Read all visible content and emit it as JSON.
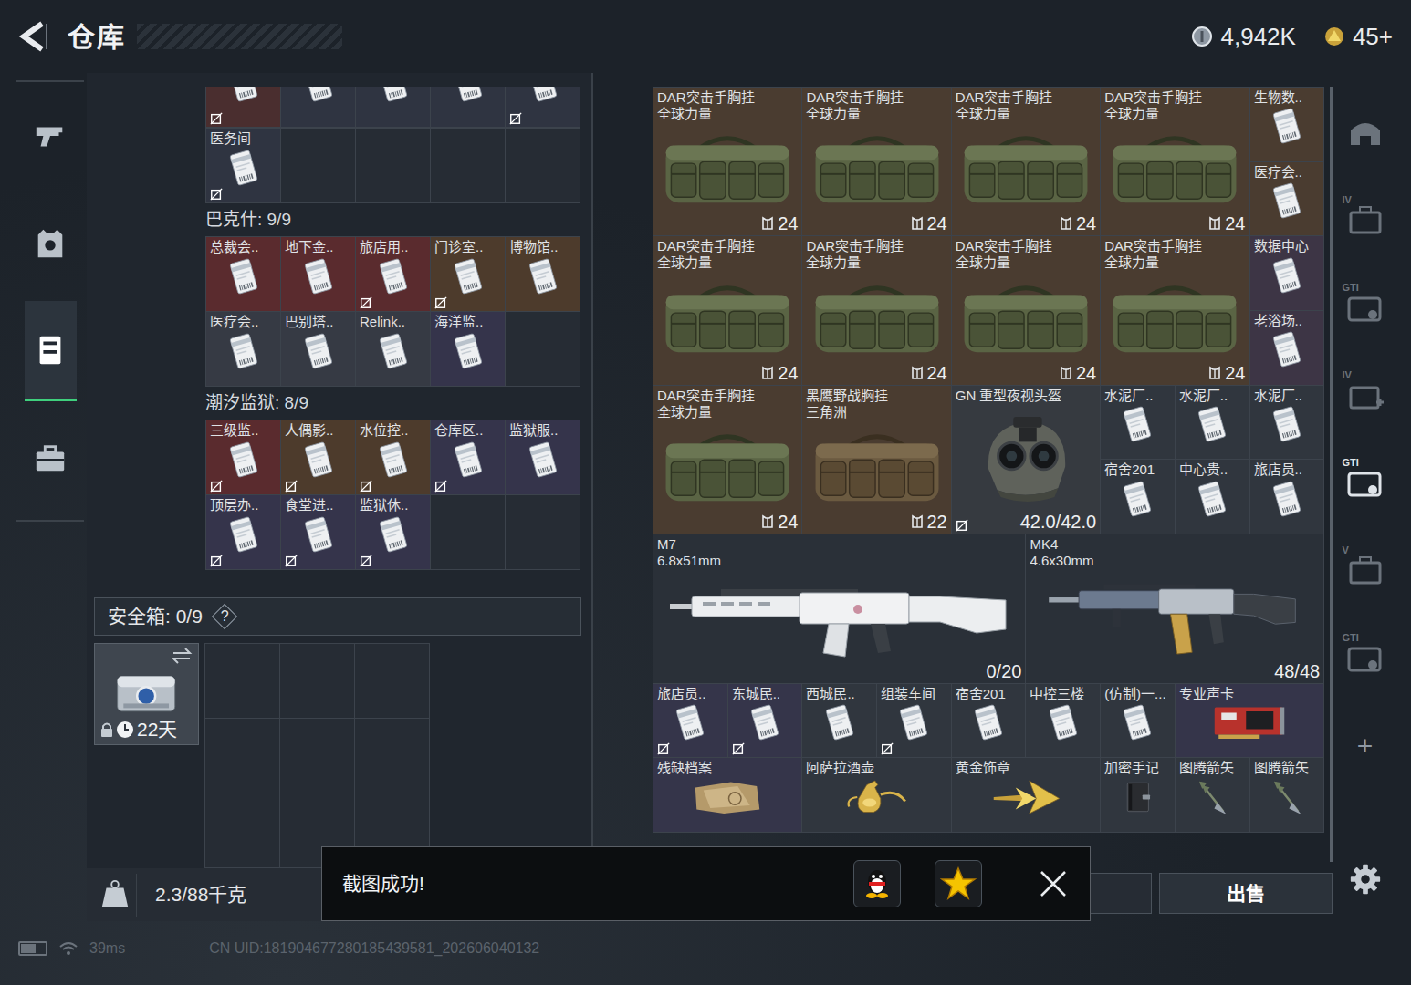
{
  "header": {
    "title": "仓库",
    "currencies": [
      {
        "kind": "silver",
        "value": "4,942K"
      },
      {
        "kind": "gold",
        "value": "45+"
      }
    ]
  },
  "nav": [
    {
      "kind": "gun",
      "selected": false
    },
    {
      "kind": "vest",
      "selected": false
    },
    {
      "kind": "locker",
      "selected": true
    },
    {
      "kind": "case",
      "selected": false
    }
  ],
  "key_sections": [
    {
      "rows": [
        {
          "clipped": true,
          "slots": [
            {
              "kind": "card",
              "locked": true,
              "color": "#4a2e2f"
            },
            {
              "kind": "card",
              "locked": false,
              "color": "#2f3441"
            },
            {
              "kind": "card",
              "locked": false,
              "color": "#2f3441"
            },
            {
              "kind": "card",
              "locked": false,
              "color": "#2f3441"
            },
            {
              "kind": "card",
              "locked": true,
              "color": "#2f3441"
            }
          ]
        },
        {
          "clipped": false,
          "slots": [
            {
              "kind": "card",
              "name": "医务间",
              "locked": true,
              "color": "#2f3441"
            },
            {
              "kind": "empty"
            },
            {
              "kind": "empty"
            },
            {
              "kind": "empty"
            },
            {
              "kind": "empty"
            }
          ]
        }
      ]
    },
    {
      "label": "巴克什: 9/9",
      "rows": [
        {
          "clipped": false,
          "slots": [
            {
              "kind": "card",
              "name": "总裁会..",
              "locked": false,
              "color": "#5a2b2e"
            },
            {
              "kind": "card",
              "name": "地下金..",
              "locked": false,
              "color": "#5a2b2e"
            },
            {
              "kind": "card",
              "name": "旅店用..",
              "locked": true,
              "color": "#5a2b2e"
            },
            {
              "kind": "card",
              "name": "门诊室..",
              "locked": true,
              "color": "#4d3b2c"
            },
            {
              "kind": "card",
              "name": "博物馆..",
              "locked": false,
              "color": "#4d3b2c"
            }
          ]
        },
        {
          "clipped": false,
          "slots": [
            {
              "kind": "card",
              "name": "医疗会..",
              "locked": false,
              "color": "#363a44"
            },
            {
              "kind": "card",
              "name": "巴别塔..",
              "locked": false,
              "color": "#363a44"
            },
            {
              "kind": "card",
              "name": "Relink..",
              "locked": false,
              "color": "#363a44"
            },
            {
              "kind": "card",
              "name": "海洋监..",
              "locked": false,
              "color": "#35344b"
            },
            {
              "kind": "empty"
            }
          ]
        }
      ]
    },
    {
      "label": "潮汐监狱: 8/9",
      "rows": [
        {
          "clipped": false,
          "slots": [
            {
              "kind": "card",
              "name": "三级监..",
              "locked": true,
              "color": "#5a2b2e"
            },
            {
              "kind": "card",
              "name": "人偶影..",
              "locked": true,
              "color": "#4d3b2c"
            },
            {
              "kind": "card",
              "name": "水位控..",
              "locked": true,
              "color": "#4d3b2c"
            },
            {
              "kind": "card",
              "name": "仓库区..",
              "locked": true,
              "color": "#35344b"
            },
            {
              "kind": "card",
              "name": "监狱服..",
              "locked": false,
              "color": "#35344b"
            }
          ]
        },
        {
          "clipped": false,
          "slots": [
            {
              "kind": "card",
              "name": "顶层办..",
              "locked": true,
              "color": "#35344b"
            },
            {
              "kind": "card",
              "name": "食堂进..",
              "locked": true,
              "color": "#35344b"
            },
            {
              "kind": "card",
              "name": "监狱休..",
              "locked": true,
              "color": "#35344b"
            },
            {
              "kind": "empty"
            },
            {
              "kind": "empty"
            }
          ]
        }
      ]
    }
  ],
  "safe": {
    "label": "安全箱: 0/9",
    "help": "?",
    "item": {
      "days": "22天",
      "locked": true
    },
    "slots": [
      {
        "kind": "empty"
      },
      {
        "kind": "empty"
      },
      {
        "kind": "empty"
      },
      {
        "kind": "empty"
      },
      {
        "kind": "empty"
      },
      {
        "kind": "empty"
      },
      {
        "kind": "empty"
      },
      {
        "kind": "empty"
      },
      {
        "kind": "empty"
      }
    ]
  },
  "weight": {
    "value": "2.3/88千克"
  },
  "stash": [
    {
      "kind": "bag",
      "name": "DAR突击手胸挂",
      "sub": "全球力量",
      "value": "24",
      "locked": false,
      "color": "#4a3c30"
    },
    {
      "kind": "bag",
      "name": "DAR突击手胸挂",
      "sub": "全球力量",
      "value": "24",
      "locked": false,
      "color": "#4a3c30"
    },
    {
      "kind": "bag",
      "name": "DAR突击手胸挂",
      "sub": "全球力量",
      "value": "24",
      "locked": false,
      "color": "#4a3c30"
    },
    {
      "kind": "bag",
      "name": "DAR突击手胸挂",
      "sub": "全球力量",
      "value": "24",
      "locked": false,
      "color": "#4a3c30"
    },
    {
      "kind": "card",
      "name": "生物数..",
      "locked": false,
      "color": "#4a3c30"
    },
    {
      "kind": "card",
      "name": "医疗会..",
      "locked": false,
      "color": "#4a3c30"
    },
    {
      "kind": "bag",
      "name": "DAR突击手胸挂",
      "sub": "全球力量",
      "value": "24",
      "locked": false,
      "color": "#4a3c30"
    },
    {
      "kind": "bag",
      "name": "DAR突击手胸挂",
      "sub": "全球力量",
      "value": "24",
      "locked": false,
      "color": "#4a3c30"
    },
    {
      "kind": "bag",
      "name": "DAR突击手胸挂",
      "sub": "全球力量",
      "value": "24",
      "locked": false,
      "color": "#4a3c30"
    },
    {
      "kind": "bag",
      "name": "DAR突击手胸挂",
      "sub": "全球力量",
      "value": "24",
      "locked": false,
      "color": "#4a3c30"
    },
    {
      "kind": "card",
      "name": "数据中心",
      "locked": false,
      "color": "#3d3545"
    },
    {
      "kind": "card",
      "name": "老浴场..",
      "locked": false,
      "color": "#3d3545"
    },
    {
      "kind": "bag",
      "name": "DAR突击手胸挂",
      "sub": "全球力量",
      "value": "24",
      "locked": false,
      "color": "#4a3c30"
    },
    {
      "kind": "bag-tan",
      "name": "黑鹰野战胸挂",
      "sub": "三角洲",
      "value": "22",
      "locked": false,
      "color": "#4a3c30"
    },
    {
      "kind": "helmet",
      "name": "GN 重型夜视头盔",
      "value": "42.0/42.0",
      "locked": true,
      "color": "#363a40"
    },
    {
      "kind": "card",
      "name": "水泥厂..",
      "locked": false,
      "color": "#30363e"
    },
    {
      "kind": "card",
      "name": "水泥厂..",
      "locked": false,
      "color": "#30363e"
    },
    {
      "kind": "card",
      "name": "水泥厂..",
      "locked": false,
      "color": "#30363e"
    },
    {
      "kind": "card",
      "name": "宿舍201",
      "locked": false,
      "color": "#30363e"
    },
    {
      "kind": "card",
      "name": "中心贵..",
      "locked": false,
      "color": "#30363e"
    },
    {
      "kind": "card",
      "name": "旅店员..",
      "locked": false,
      "color": "#30363e"
    },
    {
      "kind": "rifle5",
      "name": "M7",
      "sub": "6.8x51mm",
      "value": "0/20",
      "locked": false,
      "color": "#2a3038"
    },
    {
      "kind": "rifle4",
      "name": "MK4",
      "sub": "4.6x30mm",
      "value": "48/48",
      "locked": false,
      "color": "#2a3038"
    },
    {
      "kind": "card",
      "name": "旅店员..",
      "locked": true,
      "color": "#35354a"
    },
    {
      "kind": "card",
      "name": "东城民..",
      "locked": true,
      "color": "#35354a"
    },
    {
      "kind": "card",
      "name": "西城民..",
      "locked": false,
      "color": "#30363e"
    },
    {
      "kind": "card",
      "name": "组装车间",
      "locked": true,
      "color": "#30363e"
    },
    {
      "kind": "card",
      "name": "宿舍201",
      "locked": false,
      "color": "#30363e"
    },
    {
      "kind": "card",
      "name": "中控三楼",
      "locked": false,
      "color": "#30363e"
    },
    {
      "kind": "card",
      "name": "(仿制)一...",
      "locked": false,
      "color": "#30363e"
    },
    {
      "kind": "soundcard",
      "name": "专业声卡",
      "locked": false,
      "color": "#35354a"
    },
    {
      "kind": "document",
      "name": "残缺档案",
      "locked": false,
      "color": "#35354a"
    },
    {
      "kind": "flask",
      "name": "阿萨拉酒壶",
      "locked": false,
      "color": "#30363e"
    },
    {
      "kind": "emblem",
      "name": "黄金饰章",
      "locked": false,
      "color": "#30363e"
    },
    {
      "kind": "notebook",
      "name": "加密手记",
      "locked": false,
      "color": "#30363e"
    },
    {
      "kind": "arrow",
      "name": "图腾箭矢",
      "locked": false,
      "color": "#30363e"
    },
    {
      "kind": "arrow",
      "name": "图腾箭矢",
      "locked": false,
      "color": "#30363e"
    }
  ],
  "rail": {
    "items": [
      {
        "kind": "bunker",
        "label": "",
        "selected": false
      },
      {
        "kind": "case",
        "label": "IV",
        "selected": false
      },
      {
        "kind": "ticket",
        "label": "GTI",
        "selected": false
      },
      {
        "kind": "medkit",
        "label": "IV",
        "selected": false
      },
      {
        "kind": "ticket",
        "label": "GTI",
        "selected": true
      },
      {
        "kind": "case",
        "label": "V",
        "selected": false
      },
      {
        "kind": "ticket",
        "label": "GTI",
        "selected": false
      }
    ],
    "add": "+"
  },
  "actions": {
    "sell": "出售"
  },
  "toast": {
    "message": "截图成功!"
  },
  "status_bar": {
    "battery": {
      "level": 0.6
    },
    "latency": "39ms",
    "uid": "CN UID:181904677280185439581_202606040132"
  }
}
